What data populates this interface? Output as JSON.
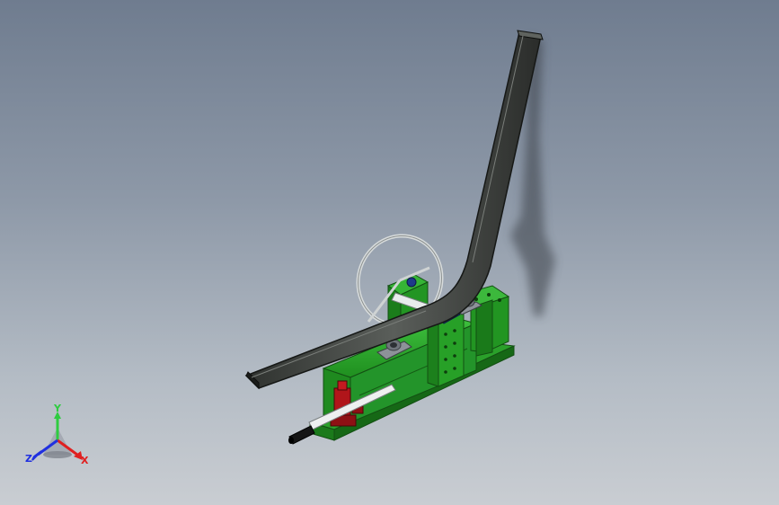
{
  "viewport": {
    "background_top": "#6f7c8f",
    "background_bottom": "#c9cdd2"
  },
  "model": {
    "frame_color": "#2ea82e",
    "tube_color": "#4a4d4a",
    "jack_color": "#b0151a",
    "bearing_color": "#1e3a8a",
    "handle_color": "#e6e6e6"
  },
  "triad": {
    "y_label": "Y",
    "x_label": "X",
    "z_label": "Z",
    "y_color": "#2ecc40",
    "x_color": "#e02020",
    "z_color": "#2030e0"
  }
}
